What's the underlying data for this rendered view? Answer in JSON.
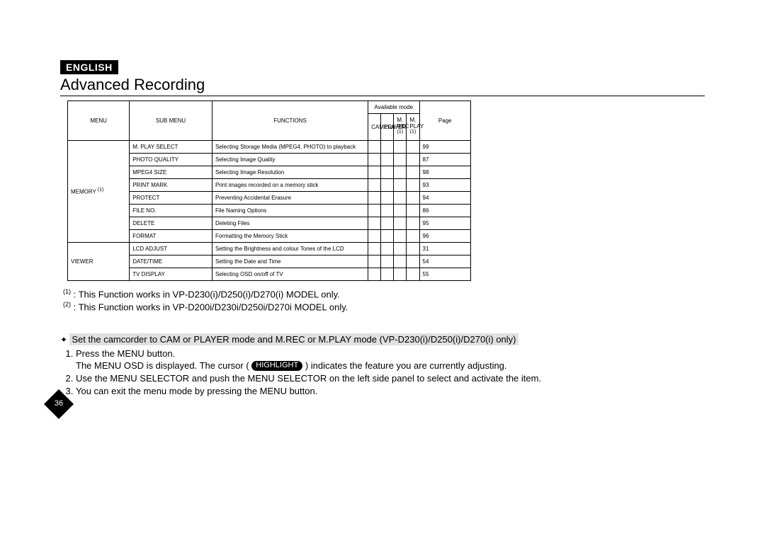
{
  "language_badge": "ENGLISH",
  "title": "Advanced Recording",
  "table": {
    "headers": {
      "menu": "MENU",
      "sub_menu": "SUB MENU",
      "functions": "FUNCTIONS",
      "available_mode": "Available mode",
      "camera": "CAMERA",
      "player": "PLAYER",
      "m_rec": "M. REC",
      "m_rec_ref": "(1)",
      "m_play": "M. PLAY",
      "m_play_ref": "(1)",
      "page": "Page"
    },
    "groups": [
      {
        "menu": "MEMORY",
        "menu_ref": "(1)",
        "rows": [
          {
            "sub": "M. PLAY SELECT",
            "func": "Selecting Storage Media (MPEG4, PHOTO) to playback",
            "page": "99"
          },
          {
            "sub": "PHOTO QUALITY",
            "func": "Selecting Image Quality",
            "page": "87"
          },
          {
            "sub": "MPEG4 SIZE",
            "func": "Selecting Image Resolution",
            "page": "98"
          },
          {
            "sub": "PRINT MARK",
            "func": "Print images recorded on a memory stick",
            "page": "93"
          },
          {
            "sub": "PROTECT",
            "func": "Preventing Accidental Erasure",
            "page": "94"
          },
          {
            "sub": "FILE NO.",
            "func": "File Naming Options",
            "page": "86"
          },
          {
            "sub": "DELETE",
            "func": "Deleting Files",
            "page": "95"
          },
          {
            "sub": "FORMAT",
            "func": "Formatting the Memory Stick",
            "page": "96"
          }
        ]
      },
      {
        "menu": "VIEWER",
        "rows": [
          {
            "sub": "LCD ADJUST",
            "func": "Setting the Brightness and colour Tones of the LCD",
            "page": "31"
          },
          {
            "sub": "DATE/TIME",
            "func": "Setting the Date and Time",
            "page": "54"
          },
          {
            "sub": "TV DISPLAY",
            "func": "Selecting OSD on/off of TV",
            "page": "55"
          }
        ]
      }
    ]
  },
  "footnotes": {
    "ref1_sup": "(1)",
    "ref1_text": " : This Function works in VP-D230(i)/D250(i)/D270(i) MODEL only.",
    "ref2_sup": "(2)",
    "ref2_text": " : This Function works in VP-D200i/D230i/D250i/D270i MODEL only."
  },
  "instructions": {
    "lead": "Set the camcorder to CAM or PLAYER mode and M.REC or M.PLAY mode (VP-D230(i)/D250(i)/D270(i) only)",
    "steps": [
      "Press the MENU button.",
      "",
      "Use the MENU SELECTOR and push the MENU SELECTOR on the left side panel to select and activate the item.",
      "You can exit the menu mode by pressing the MENU button."
    ],
    "step2_pre": "The MENU OSD is displayed. The cursor ( ",
    "step2_highlight": "HIGHLIGHT",
    "step2_post": " ) indicates the feature you are currently adjusting."
  },
  "page_number": "36"
}
